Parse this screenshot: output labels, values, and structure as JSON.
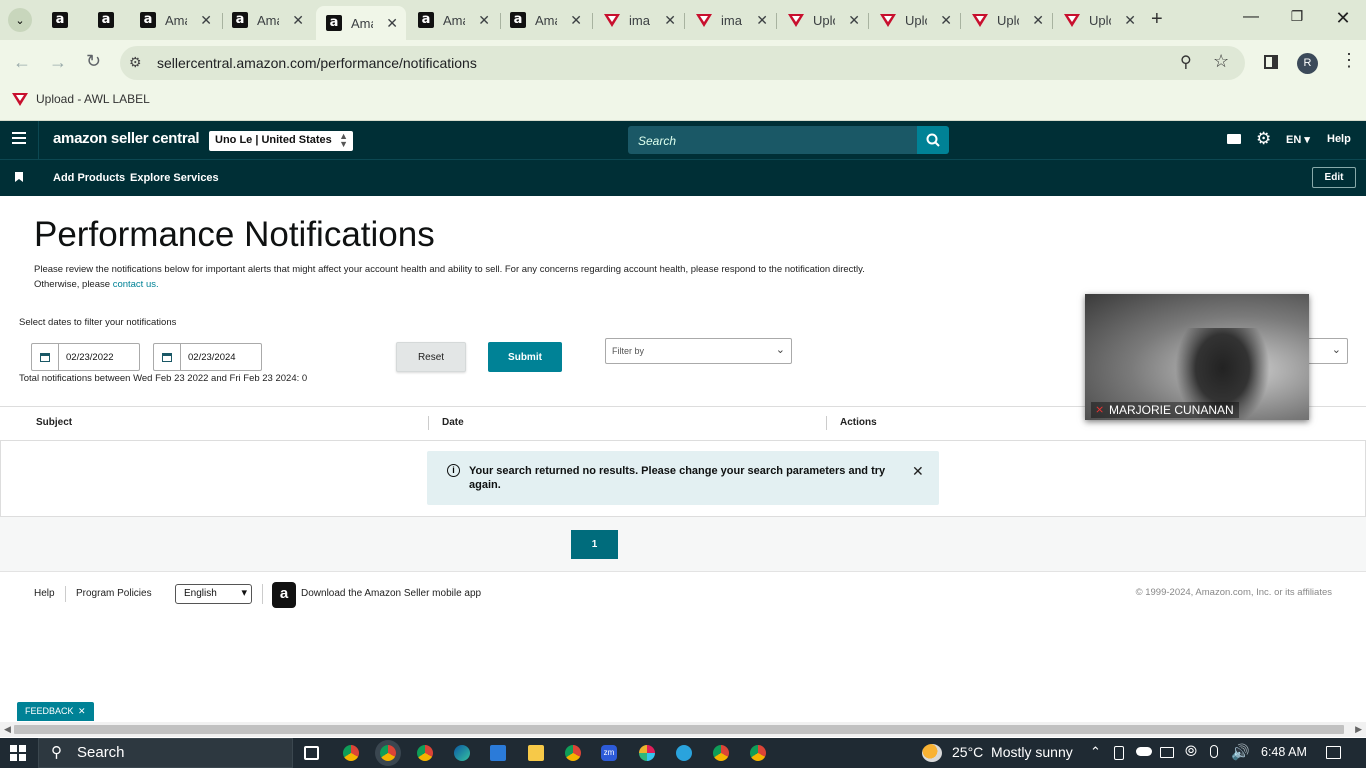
{
  "browser": {
    "tabs": [
      {
        "title": "",
        "icon": "amazon-icon"
      },
      {
        "title": "",
        "icon": "amazon-icon"
      },
      {
        "title": "Ama",
        "icon": "amazon-icon"
      },
      {
        "title": "Ama",
        "icon": "amazon-icon"
      },
      {
        "title": "Ama",
        "icon": "amazon-icon",
        "active": true
      },
      {
        "title": "Ama",
        "icon": "amazon-icon"
      },
      {
        "title": "Ama",
        "icon": "amazon-icon"
      },
      {
        "title": "ima",
        "icon": "awl-icon"
      },
      {
        "title": "ima",
        "icon": "awl-icon"
      },
      {
        "title": "Uplo",
        "icon": "awl-icon"
      },
      {
        "title": "Uplo",
        "icon": "awl-icon"
      },
      {
        "title": "Uplo",
        "icon": "awl-icon"
      },
      {
        "title": "Uplo",
        "icon": "awl-icon"
      }
    ],
    "url": "sellercentral.amazon.com/performance/notifications",
    "profile_initial": "R",
    "bookmark": "Upload - AWL LABEL"
  },
  "header": {
    "logo": "amazon seller central",
    "marketplace": "Uno Le | United States",
    "search_placeholder": "Search",
    "language": "EN",
    "help": "Help"
  },
  "nav": {
    "items": [
      "Add Products",
      "Explore Services"
    ],
    "edit": "Edit"
  },
  "page": {
    "title": "Performance Notifications",
    "description": "Please review the notifications below for important alerts that might affect your account health and ability to sell. For any concerns regarding account health, please respond to the notification directly. Otherwise, please",
    "contact_link": "contact us.",
    "filter_label": "Select dates to filter your notifications",
    "start_date": "02/23/2022",
    "end_date": "02/23/2024",
    "reset": "Reset",
    "submit": "Submit",
    "filter_placeholder": "Filter by",
    "total_text": "Total notifications between Wed Feb 23 2022 and Fri Feb 23 2024: 0"
  },
  "table": {
    "columns": [
      "Subject",
      "Date",
      "Actions"
    ],
    "empty_message": "Your search returned no results. Please change your search parameters and try again."
  },
  "pagination": {
    "current": "1"
  },
  "footer": {
    "help": "Help",
    "policies": "Program Policies",
    "language": "English",
    "app_text": "Download the Amazon Seller mobile app",
    "copyright": "© 1999-2024, Amazon.com, Inc. or its affiliates"
  },
  "video": {
    "name": "MARJORIE CUNANAN"
  },
  "feedback": "FEEDBACK",
  "taskbar": {
    "search": "Search",
    "weather": "25°C  Mostly sunny",
    "time": "6:48 AM"
  },
  "colors": {
    "header_bg": "#002f36",
    "accent": "#008296"
  }
}
